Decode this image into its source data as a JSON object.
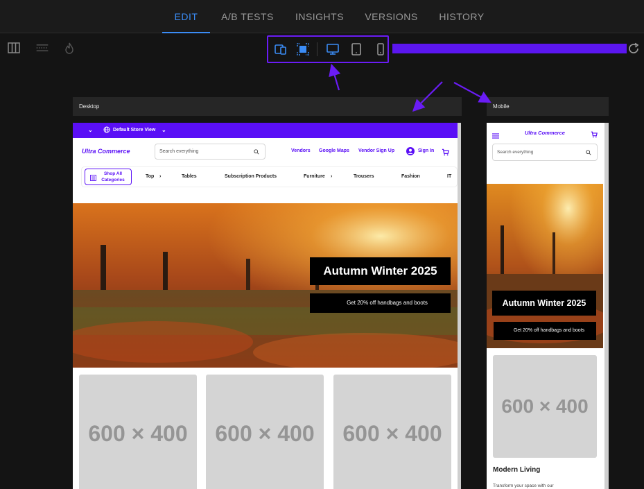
{
  "tabs": [
    {
      "label": "EDIT",
      "active": true
    },
    {
      "label": "A/B TESTS",
      "active": false
    },
    {
      "label": "INSIGHTS",
      "active": false
    },
    {
      "label": "VERSIONS",
      "active": false
    },
    {
      "label": "HISTORY",
      "active": false
    }
  ],
  "toolbar": {
    "left_icons": [
      "columns-icon",
      "ruler-icon",
      "flame-icon"
    ],
    "device_icons": [
      "responsive-icon",
      "fit-screen-icon",
      "desktop-icon",
      "tablet-icon",
      "mobile-icon"
    ],
    "right_icon": "refresh-icon"
  },
  "colors": {
    "accent_blue": "#3b8cf5",
    "brand_purple": "#5a0ff6",
    "annotation": "#6a1cf5"
  },
  "desktop": {
    "label": "Desktop",
    "promo": {
      "store_view": "Default Store View"
    },
    "header": {
      "logo": "Ultra Commerce",
      "search_placeholder": "Search everything",
      "links": [
        "Vendors",
        "Google Maps",
        "Vendor Sign Up"
      ],
      "sign_in": "Sign In"
    },
    "categories": {
      "shop_all_line1": "Shop All",
      "shop_all_line2": "Categories",
      "items": [
        "Top",
        "Tables",
        "Subscription Products",
        "Furniture",
        "Trousers",
        "Fashion",
        "IT"
      ]
    },
    "hero": {
      "title": "Autumn Winter 2025",
      "subtitle": "Get 20% off handbags and boots"
    },
    "placeholders": [
      "600 × 400",
      "600 × 400",
      "600 × 400"
    ]
  },
  "mobile": {
    "label": "Mobile",
    "logo": "Ultra Commerce",
    "search_placeholder": "Search everything",
    "hero": {
      "title": "Autumn Winter 2025",
      "subtitle": "Get 20% off handbags and boots"
    },
    "placeholder": "600 × 400",
    "section_title": "Modern Living",
    "section_text": "Transform your space with our"
  }
}
